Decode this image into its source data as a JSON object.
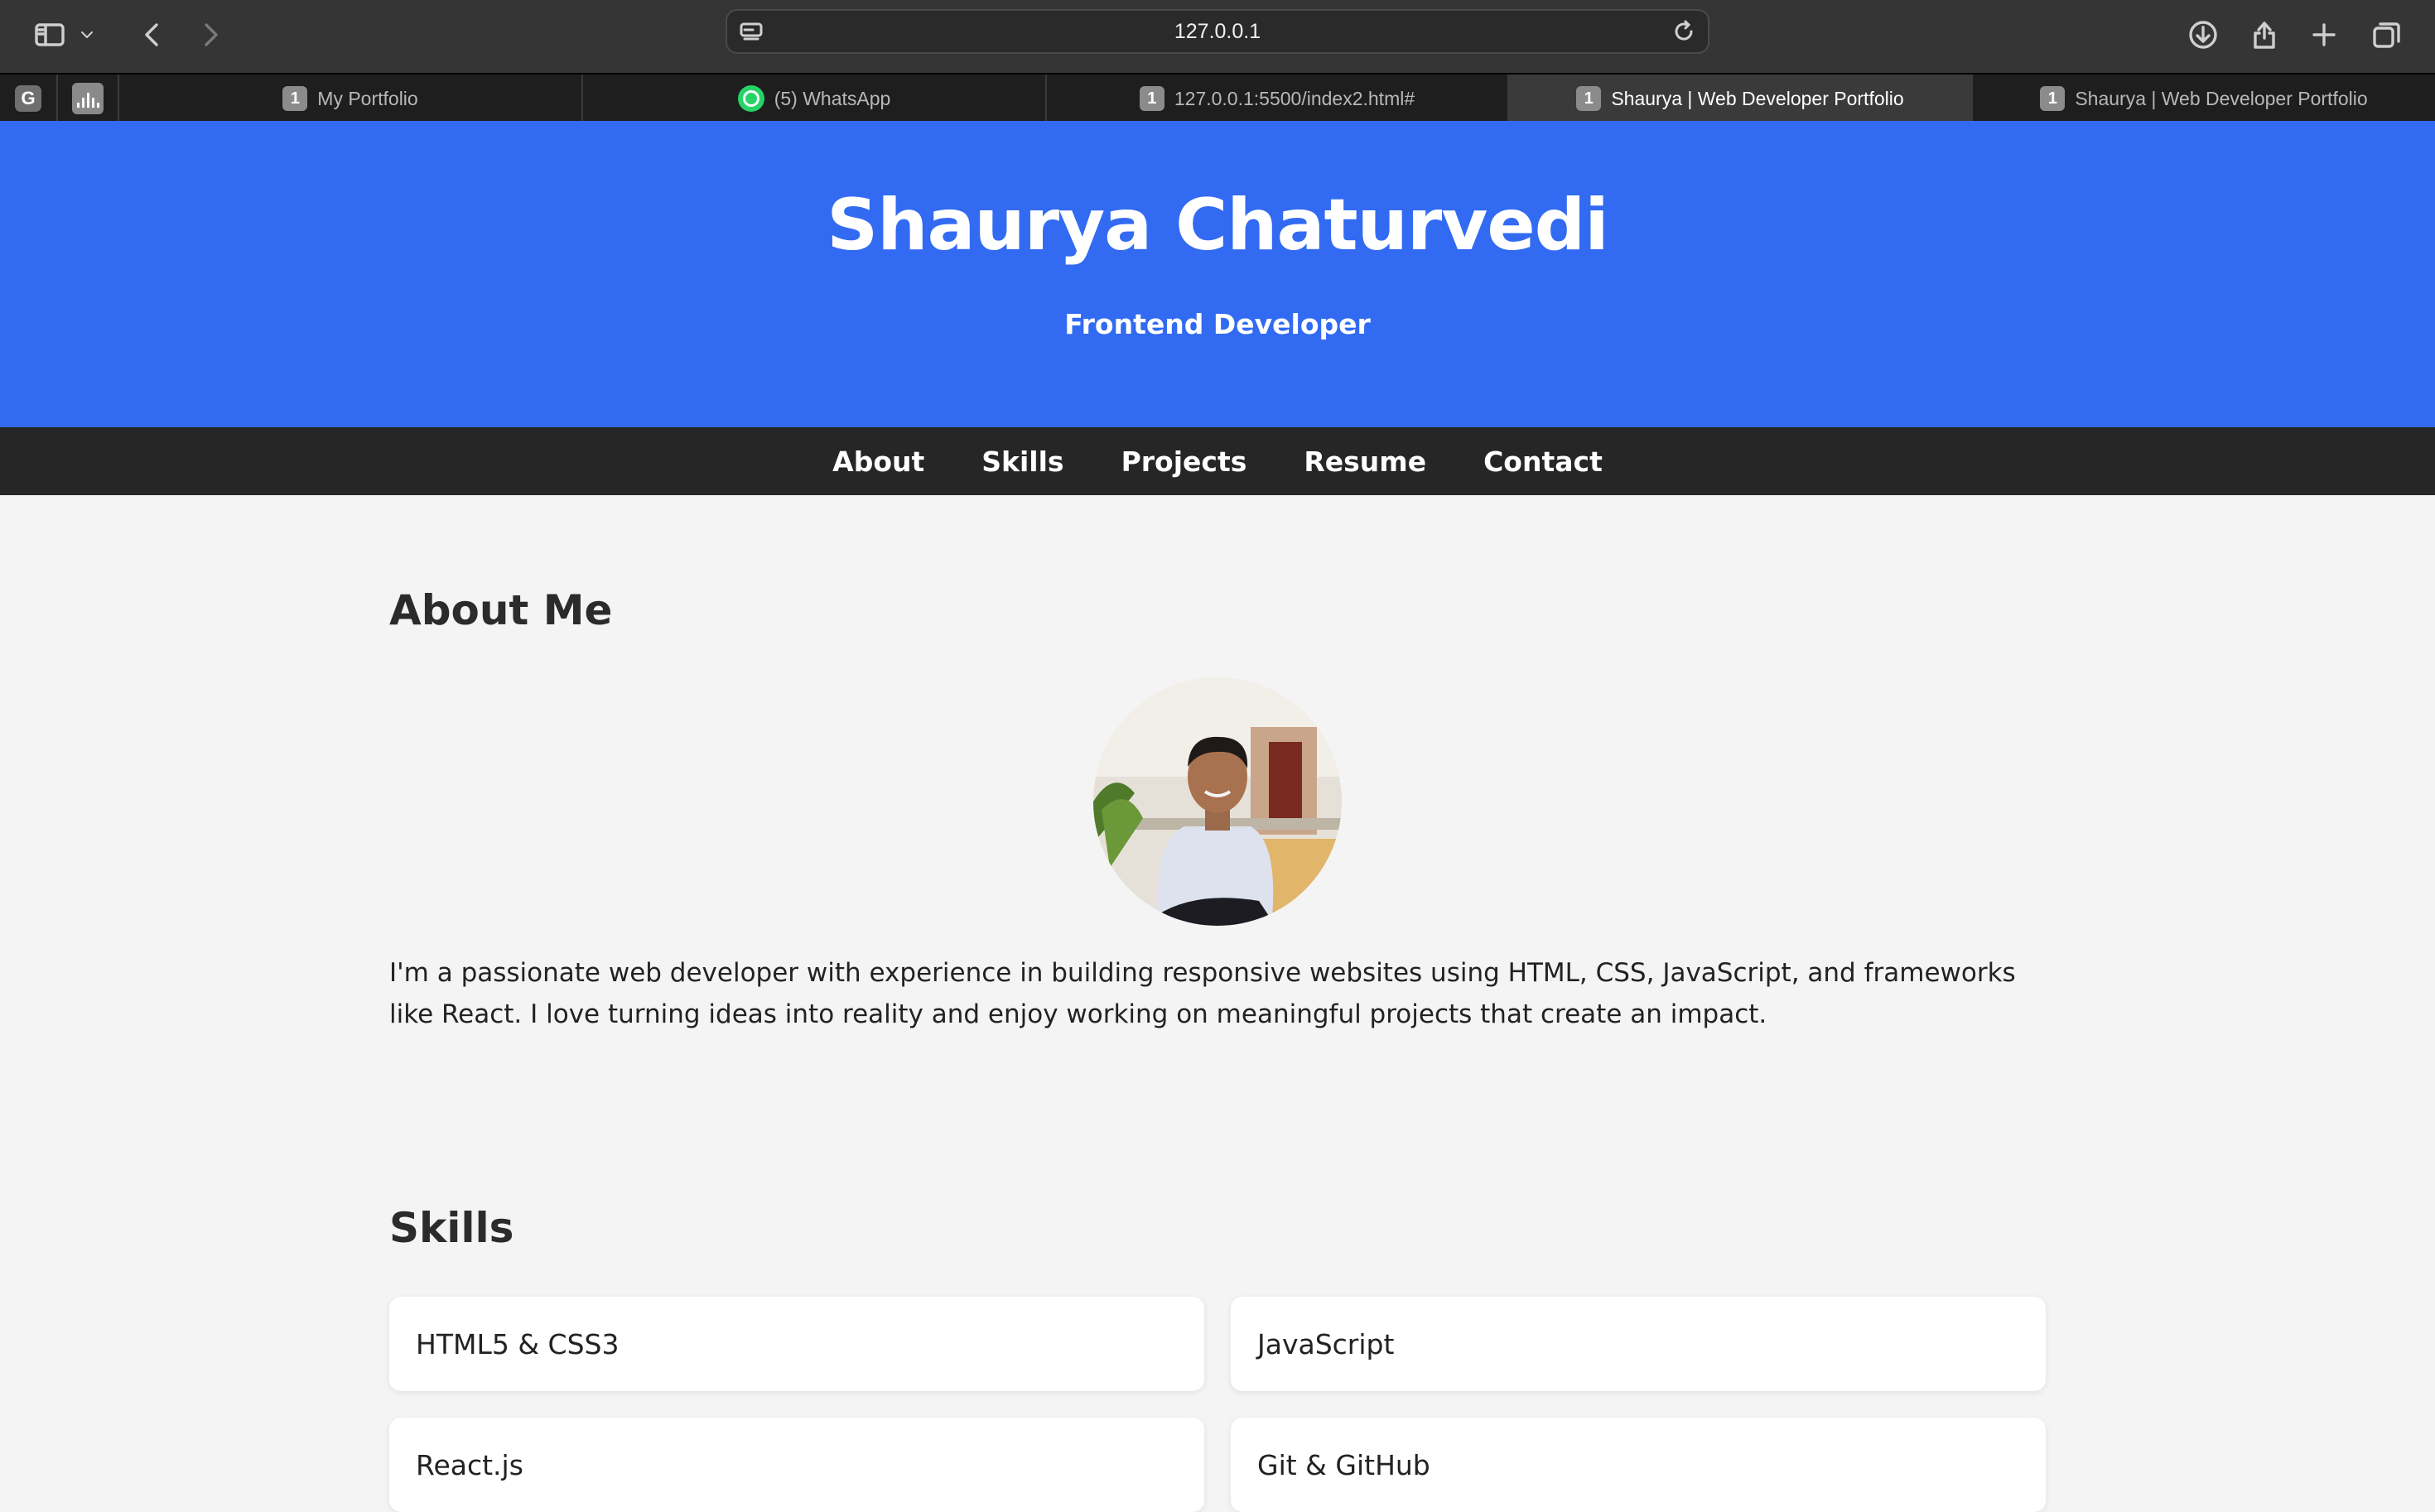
{
  "browser": {
    "url": "127.0.0.1",
    "tabs": [
      {
        "label": "My Portfolio",
        "badge": "1"
      },
      {
        "label": "(5) WhatsApp"
      },
      {
        "label": "127.0.0.1:5500/index2.html#",
        "badge": "1"
      },
      {
        "label": "Shaurya | Web Developer Portfolio",
        "badge": "1",
        "active": true
      },
      {
        "label": "Shaurya | Web Developer Portfolio",
        "badge": "1"
      }
    ],
    "pinned": {
      "g_label": "G"
    }
  },
  "header": {
    "name": "Shaurya Chaturvedi",
    "role": "Frontend Developer",
    "background_color": "#326bf2"
  },
  "nav": {
    "items": [
      "About",
      "Skills",
      "Projects",
      "Resume",
      "Contact"
    ]
  },
  "about": {
    "title": "About Me",
    "text": "I'm a passionate web developer with experience in building responsive websites using HTML, CSS, JavaScript, and frameworks like React. I love turning ideas into reality and enjoy working on meaningful projects that create an impact."
  },
  "skills": {
    "title": "Skills",
    "items": [
      "HTML5 & CSS3",
      "JavaScript",
      "React.js",
      "Git & GitHub"
    ]
  }
}
